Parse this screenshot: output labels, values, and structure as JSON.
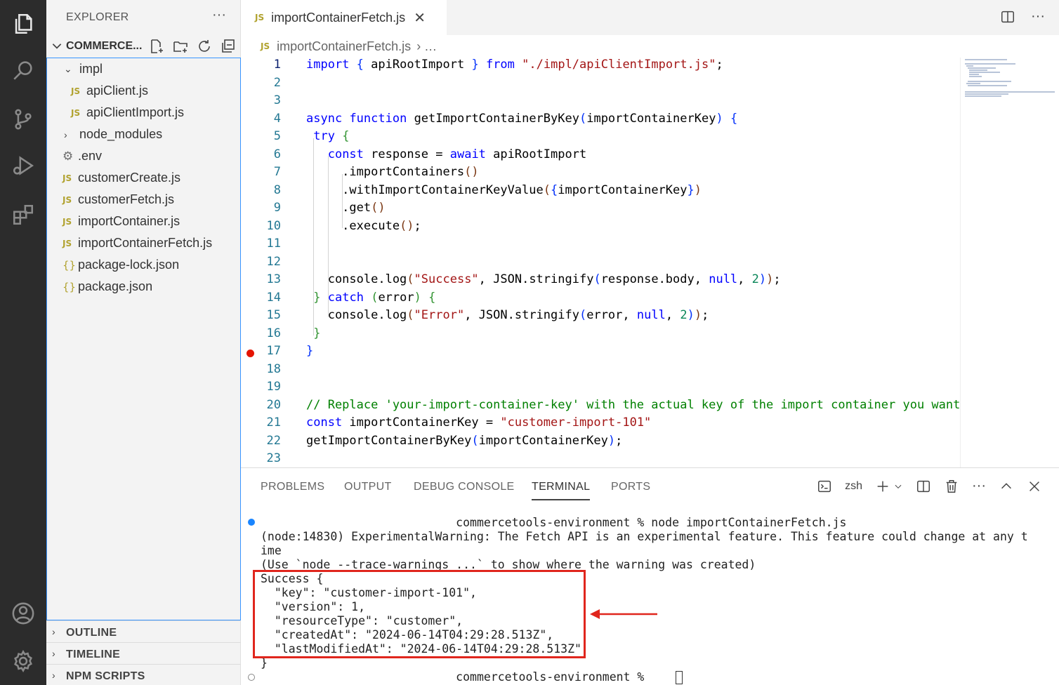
{
  "sidebar": {
    "title": "EXPLORER",
    "more": "···",
    "folder_name": "COMMERCE...",
    "items": [
      {
        "label": "impl",
        "kind": "folder-open"
      },
      {
        "label": "apiClient.js",
        "kind": "js"
      },
      {
        "label": "apiClientImport.js",
        "kind": "js"
      },
      {
        "label": "node_modules",
        "kind": "folder-closed"
      },
      {
        "label": ".env",
        "kind": "env"
      },
      {
        "label": "customerCreate.js",
        "kind": "js"
      },
      {
        "label": "customerFetch.js",
        "kind": "js"
      },
      {
        "label": "importContainer.js",
        "kind": "js"
      },
      {
        "label": "importContainerFetch.js",
        "kind": "js"
      },
      {
        "label": "package-lock.json",
        "kind": "json"
      },
      {
        "label": "package.json",
        "kind": "json"
      }
    ],
    "sections": [
      "OUTLINE",
      "TIMELINE",
      "NPM SCRIPTS"
    ]
  },
  "editor": {
    "tab_icon": "JS",
    "tab_label": "importContainerFetch.js",
    "tab_close": "✕",
    "breadcrumb_file": "importContainerFetch.js",
    "breadcrumb_rest": "› …",
    "line_numbers": [
      "1",
      "2",
      "3",
      "4",
      "5",
      "6",
      "7",
      "8",
      "9",
      "10",
      "11",
      "12",
      "13",
      "14",
      "15",
      "16",
      "17",
      "18",
      "19",
      "20",
      "21",
      "22",
      "23"
    ],
    "breakpoint_line": 17
  },
  "panel": {
    "tabs": [
      "PROBLEMS",
      "OUTPUT",
      "DEBUG CONSOLE",
      "TERMINAL",
      "PORTS"
    ],
    "active_tab": "TERMINAL",
    "shell_label": "zsh",
    "terminal_lines": [
      "                            commercetools-environment % node importContainerFetch.js",
      "(node:14830) ExperimentalWarning: The Fetch API is an experimental feature. This feature could change at any t",
      "ime",
      "(Use `node --trace-warnings ...` to show where the warning was created)",
      "Success {",
      "  \"key\": \"customer-import-101\",",
      "  \"version\": 1,",
      "  \"resourceType\": \"customer\",",
      "  \"createdAt\": \"2024-06-14T04:29:28.513Z\",",
      "  \"lastModifiedAt\": \"2024-06-14T04:29:28.513Z\"",
      "}",
      "                            commercetools-environment % "
    ]
  },
  "colors": {
    "activity_bg": "#2c2c2c",
    "sidebar_bg": "#f3f3f3",
    "accent": "#3794ff",
    "highlight": "#e0261d",
    "keyword": "#0000ff",
    "string": "#a31515",
    "comment": "#008000"
  }
}
